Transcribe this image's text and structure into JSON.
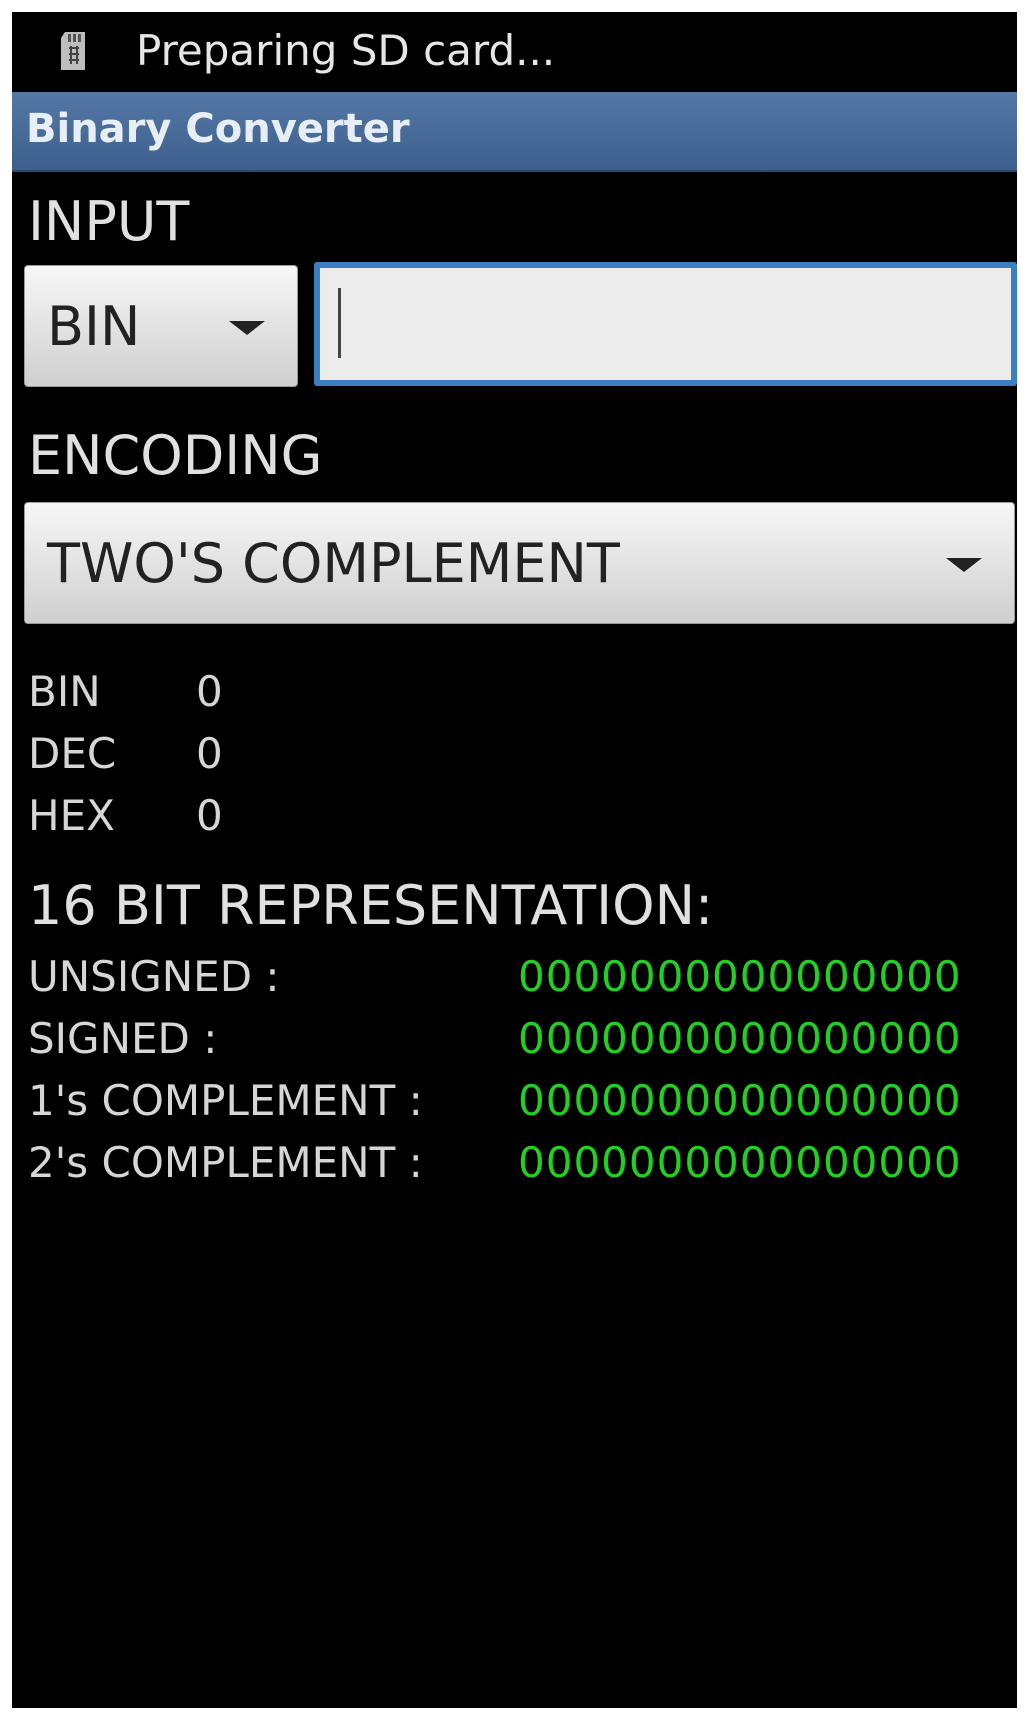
{
  "status_bar": {
    "icon": "sd-card-icon",
    "text": "Preparing SD card..."
  },
  "app": {
    "title": "Binary Converter"
  },
  "input": {
    "label": "INPUT",
    "base_selected": "BIN",
    "value": ""
  },
  "encoding": {
    "label": "ENCODING",
    "selected": "TWO'S COMPLEMENT"
  },
  "results": [
    {
      "label": "BIN",
      "value": "0"
    },
    {
      "label": "DEC",
      "value": "0"
    },
    {
      "label": "HEX",
      "value": "0"
    }
  ],
  "representation": {
    "heading": "16 BIT REPRESENTATION:",
    "rows": [
      {
        "label": "UNSIGNED :",
        "value": "0000000000000000"
      },
      {
        "label": "SIGNED :",
        "value": "0000000000000000"
      },
      {
        "label": "1's COMPLEMENT :",
        "value": "0000000000000000"
      },
      {
        "label": "2's COMPLEMENT :",
        "value": "0000000000000000"
      }
    ]
  },
  "colors": {
    "title_bar": "#4a6d9c",
    "input_focus_border": "#3b7fc3",
    "bits_text": "#22d022",
    "background": "#000000"
  }
}
